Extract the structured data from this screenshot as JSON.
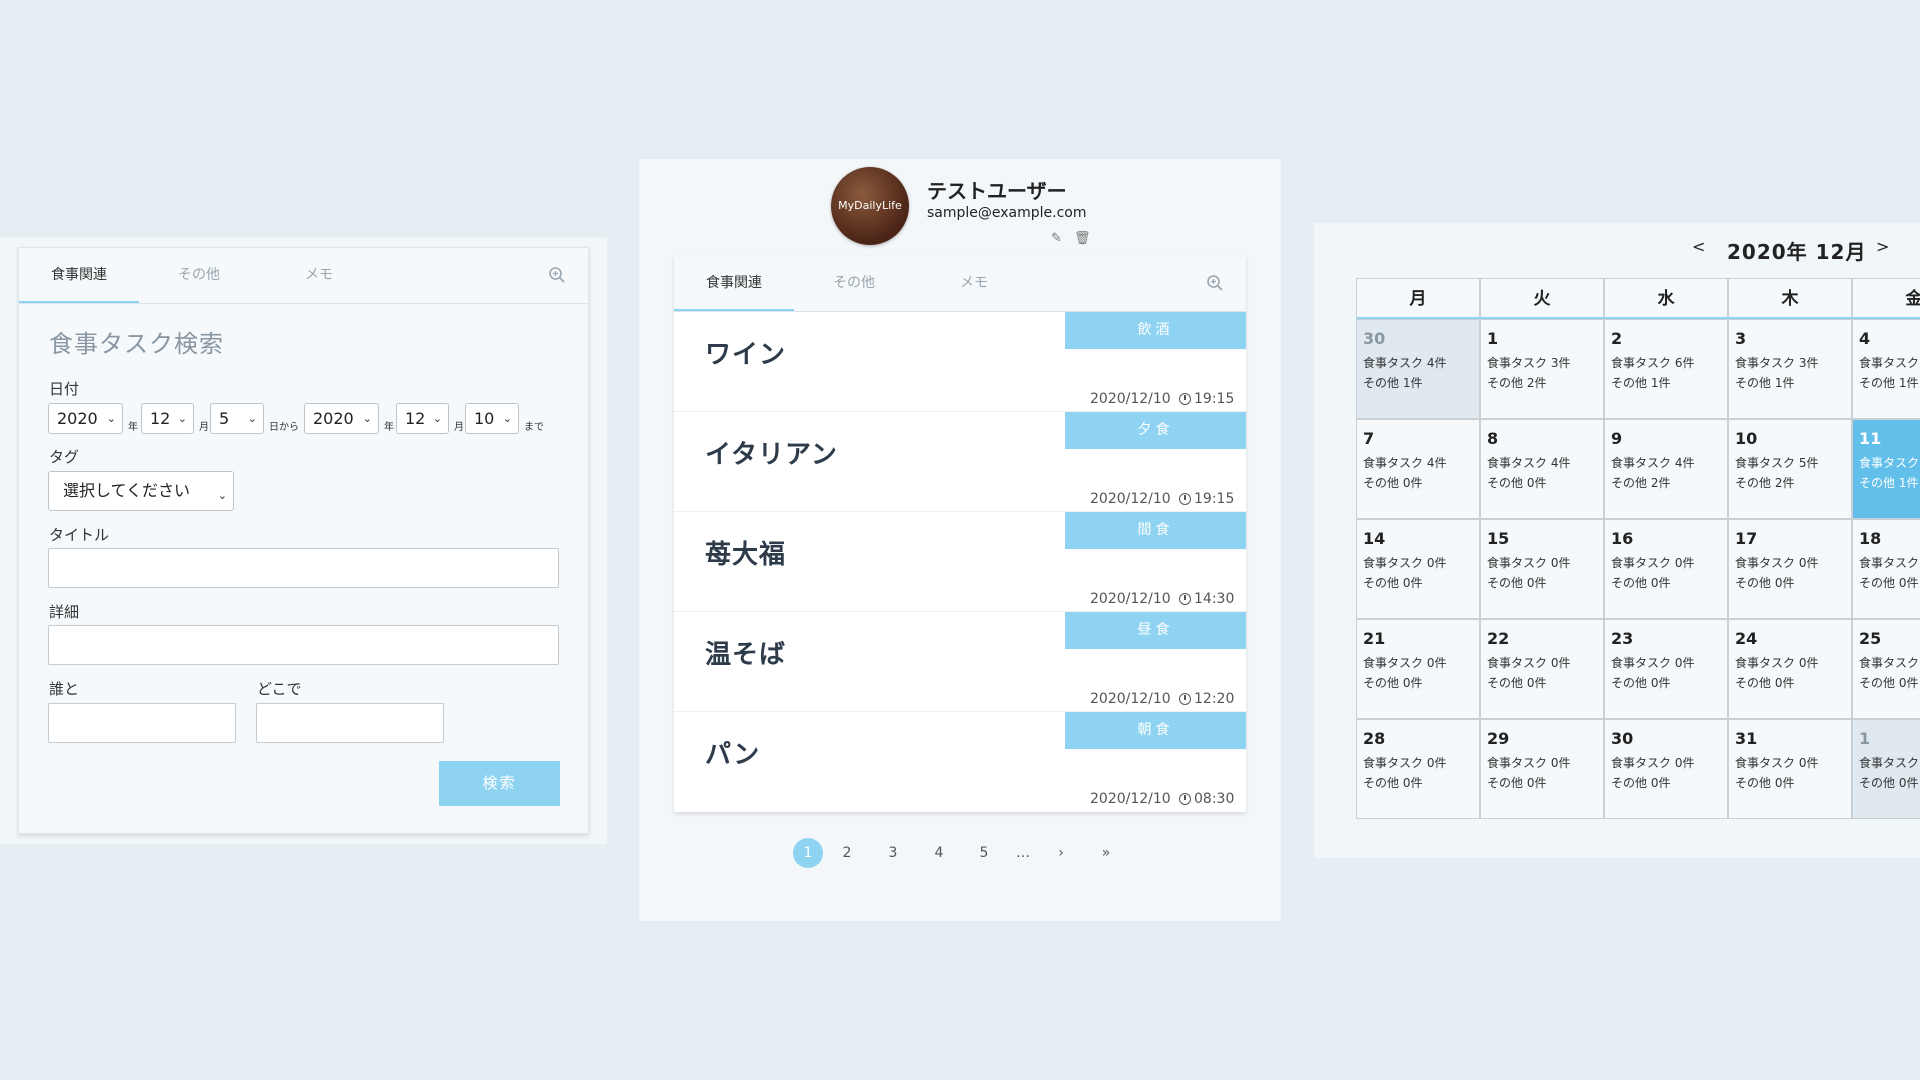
{
  "search_panel": {
    "tabs": [
      "食事関連",
      "その他",
      "メモ"
    ],
    "title": "食事タスク検索",
    "date_label": "日付",
    "from_year": "2020",
    "from_month": "12",
    "from_day": "5",
    "to_year": "2020",
    "to_month": "12",
    "to_day": "10",
    "unit_year": "年",
    "unit_month": "月",
    "unit_from": "日から",
    "unit_until": "まで",
    "tag_label": "タグ",
    "tag_placeholder": "選択してください",
    "title_label": "タイトル",
    "detail_label": "詳細",
    "with_label": "誰と",
    "where_label": "どこで",
    "search_button": "検索"
  },
  "profile": {
    "avatar_text": "MyDailyLife",
    "name": "テストユーザー",
    "email": "sample@example.com",
    "edit_icon": "✎",
    "delete_icon": "🗑"
  },
  "list_panel": {
    "tabs": [
      "食事関連",
      "その他",
      "メモ"
    ],
    "entries": [
      {
        "title": "ワイン",
        "tag": "飲酒",
        "date": "2020/12/10",
        "time": "19:15"
      },
      {
        "title": "イタリアン",
        "tag": "夕食",
        "date": "2020/12/10",
        "time": "19:15"
      },
      {
        "title": "苺大福",
        "tag": "間食",
        "date": "2020/12/10",
        "time": "14:30"
      },
      {
        "title": "温そば",
        "tag": "昼食",
        "date": "2020/12/10",
        "time": "12:20"
      },
      {
        "title": "パン",
        "tag": "朝食",
        "date": "2020/12/10",
        "time": "08:30"
      }
    ]
  },
  "pagination": {
    "pages": [
      "1",
      "2",
      "3",
      "4",
      "5"
    ],
    "ellipsis": "…",
    "next": "›",
    "last": "»",
    "current": "1"
  },
  "calendar": {
    "prev": "<",
    "next": ">",
    "title": "2020年 12月",
    "weekdays": [
      "月",
      "火",
      "水",
      "木",
      "金"
    ],
    "weeks": [
      [
        {
          "day": "30",
          "task": "食事タスク 4件",
          "other": "その他 1件",
          "muted": true
        },
        {
          "day": "1",
          "task": "食事タスク 3件",
          "other": "その他 2件"
        },
        {
          "day": "2",
          "task": "食事タスク 6件",
          "other": "その他 1件"
        },
        {
          "day": "3",
          "task": "食事タスク 3件",
          "other": "その他 1件"
        },
        {
          "day": "4",
          "task": "食事タスク",
          "other": "その他 1件"
        }
      ],
      [
        {
          "day": "7",
          "task": "食事タスク 4件",
          "other": "その他 0件"
        },
        {
          "day": "8",
          "task": "食事タスク 4件",
          "other": "その他 0件"
        },
        {
          "day": "9",
          "task": "食事タスク 4件",
          "other": "その他 2件"
        },
        {
          "day": "10",
          "task": "食事タスク 5件",
          "other": "その他 2件"
        },
        {
          "day": "11",
          "task": "食事タスク",
          "other": "その他 1件",
          "today": true
        }
      ],
      [
        {
          "day": "14",
          "task": "食事タスク 0件",
          "other": "その他 0件"
        },
        {
          "day": "15",
          "task": "食事タスク 0件",
          "other": "その他 0件"
        },
        {
          "day": "16",
          "task": "食事タスク 0件",
          "other": "その他 0件"
        },
        {
          "day": "17",
          "task": "食事タスク 0件",
          "other": "その他 0件"
        },
        {
          "day": "18",
          "task": "食事タスク",
          "other": "その他 0件"
        }
      ],
      [
        {
          "day": "21",
          "task": "食事タスク 0件",
          "other": "その他 0件"
        },
        {
          "day": "22",
          "task": "食事タスク 0件",
          "other": "その他 0件"
        },
        {
          "day": "23",
          "task": "食事タスク 0件",
          "other": "その他 0件"
        },
        {
          "day": "24",
          "task": "食事タスク 0件",
          "other": "その他 0件"
        },
        {
          "day": "25",
          "task": "食事タスク",
          "other": "その他 0件"
        }
      ],
      [
        {
          "day": "28",
          "task": "食事タスク 0件",
          "other": "その他 0件"
        },
        {
          "day": "29",
          "task": "食事タスク 0件",
          "other": "その他 0件"
        },
        {
          "day": "30",
          "task": "食事タスク 0件",
          "other": "その他 0件"
        },
        {
          "day": "31",
          "task": "食事タスク 0件",
          "other": "その他 0件"
        },
        {
          "day": "1",
          "task": "食事タスク",
          "other": "その他 0件",
          "muted": true
        }
      ]
    ]
  },
  "colors": {
    "accent": "#8fd3f2",
    "today": "#62bfea",
    "background": "#e6eef4"
  }
}
